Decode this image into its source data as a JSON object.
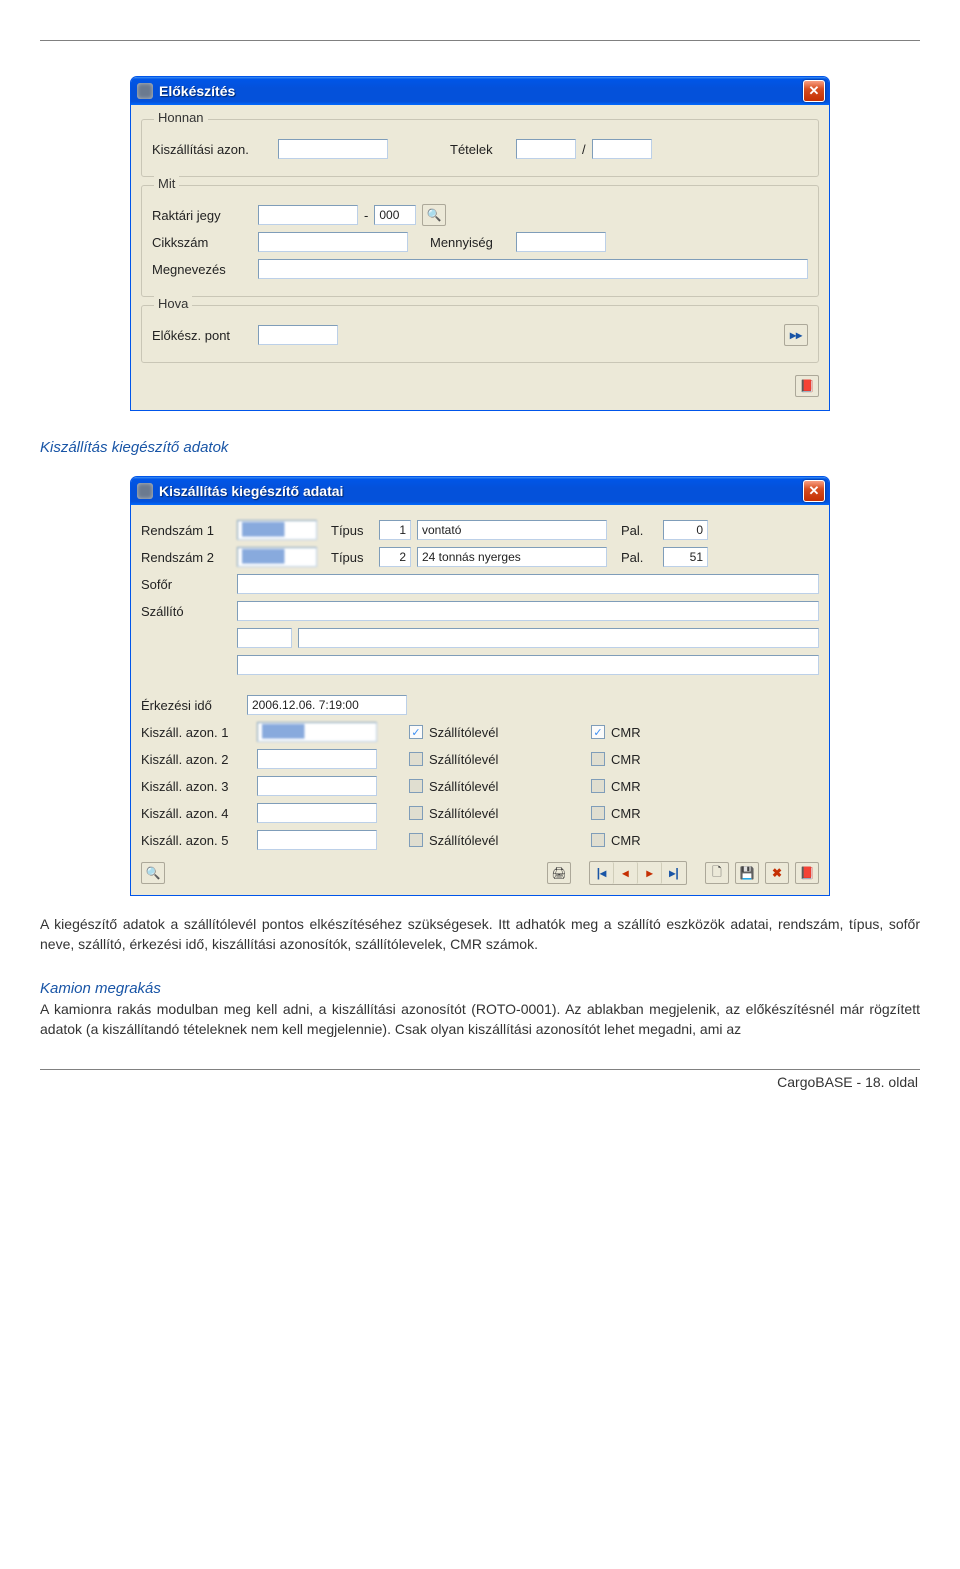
{
  "win1": {
    "title": "Előkészítés",
    "groups": {
      "honnan": {
        "legend": "Honnan",
        "kiszall_label": "Kiszállítási azon.",
        "tetelek_label": "Tételek",
        "slash": "/"
      },
      "mit": {
        "legend": "Mit",
        "raktari_label": "Raktári jegy",
        "dash": "-",
        "raktari_suffix": "000",
        "cikkszam_label": "Cikkszám",
        "mennyiseg_label": "Mennyiség",
        "megnevezes_label": "Megnevezés"
      },
      "hova": {
        "legend": "Hova",
        "elokesz_label": "Előkész. pont"
      }
    }
  },
  "section_heading": "Kiszállítás kiegészítő adatok",
  "win2": {
    "title": "Kiszállítás kiegészítő adatai",
    "labels": {
      "rendszam1": "Rendszám 1",
      "rendszam2": "Rendszám 2",
      "tipus": "Típus",
      "pal": "Pal.",
      "sofor": "Sofőr",
      "szallito": "Szállító",
      "erkezesi": "Érkezési idő",
      "kiszall1": "Kiszáll. azon. 1",
      "kiszall2": "Kiszáll. azon. 2",
      "kiszall3": "Kiszáll. azon. 3",
      "kiszall4": "Kiszáll. azon. 4",
      "kiszall5": "Kiszáll. azon. 5",
      "szallitolevel": "Szállítólevél",
      "cmr": "CMR"
    },
    "values": {
      "tipus1_num": "1",
      "tipus1_name": "vontató",
      "pal1": "0",
      "tipus2_num": "2",
      "tipus2_name": "24 tonnás nyerges",
      "pal2": "51",
      "erk_ido": "2006.12.06. 7:19:00"
    }
  },
  "para1": "A kiegészítő adatok a szállítólevél pontos elkészítéséhez szükségesek. Itt adhatók meg a szállító eszközök adatai, rendszám, típus, sofőr neve, szállító, érkezési idő, kiszállítási azonosítók, szállítólevelek, CMR számok.",
  "kamion_heading": "Kamion megrakás",
  "para2": "A kamionra rakás modulban meg kell adni, a kiszállítási azonosítót (ROTO-0001). Az ablakban megjelenik, az előkészítésnél már rögzített adatok (a kiszállítandó tételeknek nem kell megjelennie).  Csak olyan kiszállítási azonosítót lehet megadni, ami az",
  "footer": "CargoBASE - 18. oldal"
}
